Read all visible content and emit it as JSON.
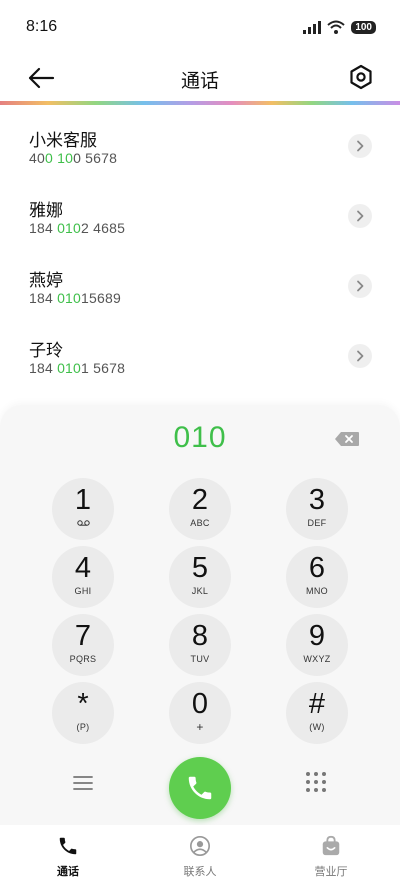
{
  "status": {
    "time": "8:16",
    "battery": "100"
  },
  "header": {
    "title": "通话"
  },
  "contacts": [
    {
      "name": "小米客服",
      "number_parts": [
        "40",
        "0",
        " ",
        "10",
        "0 5678"
      ]
    },
    {
      "name": "雅娜",
      "number_parts": [
        "184 ",
        "010",
        "2 4685"
      ]
    },
    {
      "name": "燕婷",
      "number_parts": [
        "184 ",
        "010",
        "15689"
      ]
    },
    {
      "name": "子玲",
      "number_parts": [
        "184 ",
        "010",
        "1 5678"
      ]
    }
  ],
  "dialer": {
    "input": "010",
    "keys": [
      {
        "digit": "1",
        "letters": ""
      },
      {
        "digit": "2",
        "letters": "ABC"
      },
      {
        "digit": "3",
        "letters": "DEF"
      },
      {
        "digit": "4",
        "letters": "GHI"
      },
      {
        "digit": "5",
        "letters": "JKL"
      },
      {
        "digit": "6",
        "letters": "MNO"
      },
      {
        "digit": "7",
        "letters": "PQRS"
      },
      {
        "digit": "8",
        "letters": "TUV"
      },
      {
        "digit": "9",
        "letters": "WXYZ"
      },
      {
        "digit": "*",
        "letters": "(P)"
      },
      {
        "digit": "0",
        "letters": "+"
      },
      {
        "digit": "#",
        "letters": "(W)"
      }
    ]
  },
  "nav": {
    "items": [
      {
        "label": "通话",
        "icon": "phone-icon",
        "active": true
      },
      {
        "label": "联系人",
        "icon": "person-icon",
        "active": false
      },
      {
        "label": "营业厅",
        "icon": "bag-icon",
        "active": false
      }
    ]
  },
  "colors": {
    "accent": "#3fbf4a",
    "call": "#5fce4f"
  }
}
